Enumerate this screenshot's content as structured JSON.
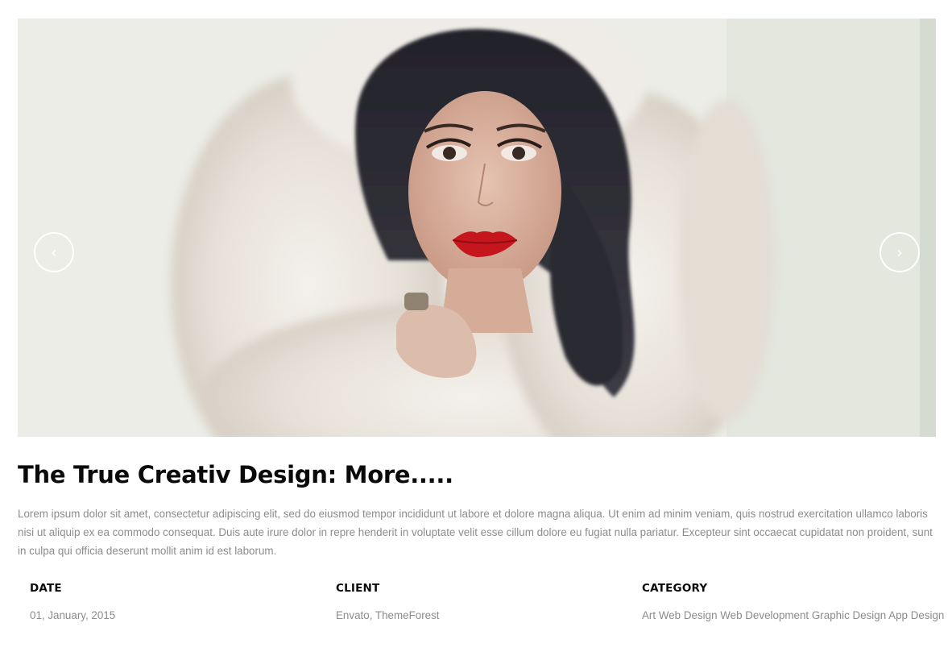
{
  "slider": {
    "prev_icon": "chevron-left-icon",
    "next_icon": "chevron-right-icon",
    "prev_label": "‹",
    "next_label": "›"
  },
  "project": {
    "title": "The True Creativ Design: More.....",
    "description": "Lorem ipsum dolor sit amet, consectetur adipiscing elit, sed do eiusmod tempor incididunt ut labore et dolore magna aliqua. Ut enim ad minim veniam, quis nostrud exercitation ullamco laboris nisi ut aliquip ex ea commodo consequat. Duis aute irure dolor in repre henderit in voluptate velit esse cillum dolore eu fugiat nulla pariatur. Excepteur sint occaecat cupidatat non proident, sunt in culpa qui officia deserunt mollit anim id est laborum."
  },
  "meta": {
    "date": {
      "label": "DATE",
      "value": "01, January, 2015"
    },
    "client": {
      "label": "CLIENT",
      "value": "Envato, ThemeForest"
    },
    "category": {
      "label": "CATEGORY",
      "value": "Art Web Design Web Development Graphic Design App Design"
    }
  },
  "colors": {
    "text_dark": "#0a0a0a",
    "text_muted": "#8c8c8c",
    "lips": "#c4161c"
  }
}
